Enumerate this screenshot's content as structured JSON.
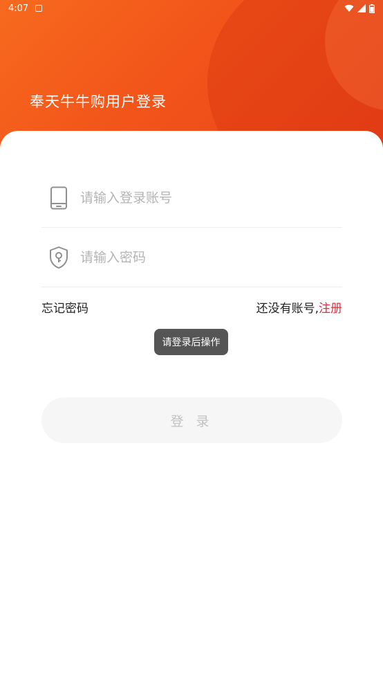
{
  "status_bar": {
    "time": "4:07"
  },
  "header": {
    "title": "奉天牛牛购用户登录"
  },
  "account_field": {
    "placeholder": "请输入登录账号",
    "value": "",
    "icon": "phone-icon"
  },
  "password_field": {
    "placeholder": "请输入密码",
    "value": "",
    "icon": "shield-key-icon"
  },
  "links": {
    "forgot_password": "忘记密码",
    "no_account": "还没有账号,",
    "register": "注册"
  },
  "toast": {
    "message": "请登录后操作"
  },
  "login_button": {
    "label": "登 录"
  },
  "colors": {
    "header_gradient_start": "#f76a1e",
    "header_gradient_end": "#e8421a",
    "register_link": "#e8283a",
    "login_button_bg": "#f6f6f6",
    "toast_bg": "#555555"
  }
}
